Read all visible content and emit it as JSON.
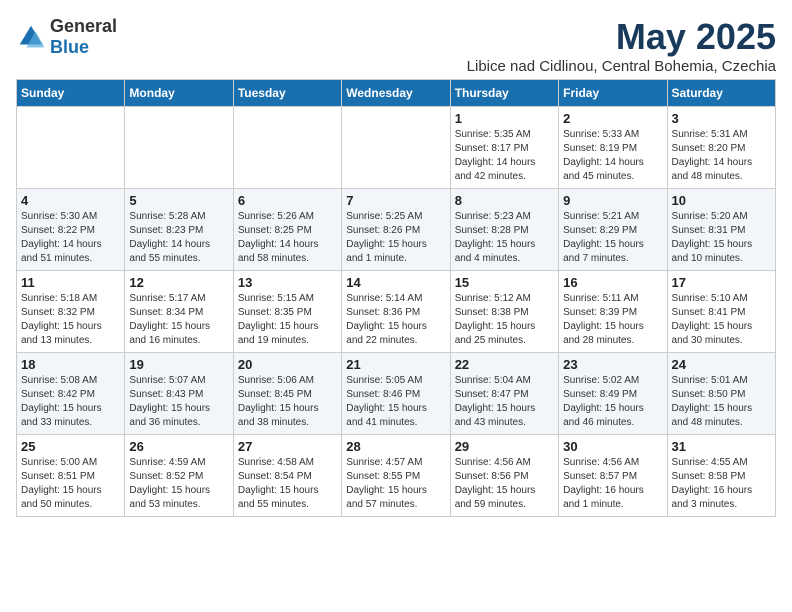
{
  "header": {
    "logo_general": "General",
    "logo_blue": "Blue",
    "month_title": "May 2025",
    "location": "Libice nad Cidlinou, Central Bohemia, Czechia"
  },
  "weekdays": [
    "Sunday",
    "Monday",
    "Tuesday",
    "Wednesday",
    "Thursday",
    "Friday",
    "Saturday"
  ],
  "weeks": [
    [
      {
        "day": "",
        "info": ""
      },
      {
        "day": "",
        "info": ""
      },
      {
        "day": "",
        "info": ""
      },
      {
        "day": "",
        "info": ""
      },
      {
        "day": "1",
        "info": "Sunrise: 5:35 AM\nSunset: 8:17 PM\nDaylight: 14 hours\nand 42 minutes."
      },
      {
        "day": "2",
        "info": "Sunrise: 5:33 AM\nSunset: 8:19 PM\nDaylight: 14 hours\nand 45 minutes."
      },
      {
        "day": "3",
        "info": "Sunrise: 5:31 AM\nSunset: 8:20 PM\nDaylight: 14 hours\nand 48 minutes."
      }
    ],
    [
      {
        "day": "4",
        "info": "Sunrise: 5:30 AM\nSunset: 8:22 PM\nDaylight: 14 hours\nand 51 minutes."
      },
      {
        "day": "5",
        "info": "Sunrise: 5:28 AM\nSunset: 8:23 PM\nDaylight: 14 hours\nand 55 minutes."
      },
      {
        "day": "6",
        "info": "Sunrise: 5:26 AM\nSunset: 8:25 PM\nDaylight: 14 hours\nand 58 minutes."
      },
      {
        "day": "7",
        "info": "Sunrise: 5:25 AM\nSunset: 8:26 PM\nDaylight: 15 hours\nand 1 minute."
      },
      {
        "day": "8",
        "info": "Sunrise: 5:23 AM\nSunset: 8:28 PM\nDaylight: 15 hours\nand 4 minutes."
      },
      {
        "day": "9",
        "info": "Sunrise: 5:21 AM\nSunset: 8:29 PM\nDaylight: 15 hours\nand 7 minutes."
      },
      {
        "day": "10",
        "info": "Sunrise: 5:20 AM\nSunset: 8:31 PM\nDaylight: 15 hours\nand 10 minutes."
      }
    ],
    [
      {
        "day": "11",
        "info": "Sunrise: 5:18 AM\nSunset: 8:32 PM\nDaylight: 15 hours\nand 13 minutes."
      },
      {
        "day": "12",
        "info": "Sunrise: 5:17 AM\nSunset: 8:34 PM\nDaylight: 15 hours\nand 16 minutes."
      },
      {
        "day": "13",
        "info": "Sunrise: 5:15 AM\nSunset: 8:35 PM\nDaylight: 15 hours\nand 19 minutes."
      },
      {
        "day": "14",
        "info": "Sunrise: 5:14 AM\nSunset: 8:36 PM\nDaylight: 15 hours\nand 22 minutes."
      },
      {
        "day": "15",
        "info": "Sunrise: 5:12 AM\nSunset: 8:38 PM\nDaylight: 15 hours\nand 25 minutes."
      },
      {
        "day": "16",
        "info": "Sunrise: 5:11 AM\nSunset: 8:39 PM\nDaylight: 15 hours\nand 28 minutes."
      },
      {
        "day": "17",
        "info": "Sunrise: 5:10 AM\nSunset: 8:41 PM\nDaylight: 15 hours\nand 30 minutes."
      }
    ],
    [
      {
        "day": "18",
        "info": "Sunrise: 5:08 AM\nSunset: 8:42 PM\nDaylight: 15 hours\nand 33 minutes."
      },
      {
        "day": "19",
        "info": "Sunrise: 5:07 AM\nSunset: 8:43 PM\nDaylight: 15 hours\nand 36 minutes."
      },
      {
        "day": "20",
        "info": "Sunrise: 5:06 AM\nSunset: 8:45 PM\nDaylight: 15 hours\nand 38 minutes."
      },
      {
        "day": "21",
        "info": "Sunrise: 5:05 AM\nSunset: 8:46 PM\nDaylight: 15 hours\nand 41 minutes."
      },
      {
        "day": "22",
        "info": "Sunrise: 5:04 AM\nSunset: 8:47 PM\nDaylight: 15 hours\nand 43 minutes."
      },
      {
        "day": "23",
        "info": "Sunrise: 5:02 AM\nSunset: 8:49 PM\nDaylight: 15 hours\nand 46 minutes."
      },
      {
        "day": "24",
        "info": "Sunrise: 5:01 AM\nSunset: 8:50 PM\nDaylight: 15 hours\nand 48 minutes."
      }
    ],
    [
      {
        "day": "25",
        "info": "Sunrise: 5:00 AM\nSunset: 8:51 PM\nDaylight: 15 hours\nand 50 minutes."
      },
      {
        "day": "26",
        "info": "Sunrise: 4:59 AM\nSunset: 8:52 PM\nDaylight: 15 hours\nand 53 minutes."
      },
      {
        "day": "27",
        "info": "Sunrise: 4:58 AM\nSunset: 8:54 PM\nDaylight: 15 hours\nand 55 minutes."
      },
      {
        "day": "28",
        "info": "Sunrise: 4:57 AM\nSunset: 8:55 PM\nDaylight: 15 hours\nand 57 minutes."
      },
      {
        "day": "29",
        "info": "Sunrise: 4:56 AM\nSunset: 8:56 PM\nDaylight: 15 hours\nand 59 minutes."
      },
      {
        "day": "30",
        "info": "Sunrise: 4:56 AM\nSunset: 8:57 PM\nDaylight: 16 hours\nand 1 minute."
      },
      {
        "day": "31",
        "info": "Sunrise: 4:55 AM\nSunset: 8:58 PM\nDaylight: 16 hours\nand 3 minutes."
      }
    ]
  ]
}
